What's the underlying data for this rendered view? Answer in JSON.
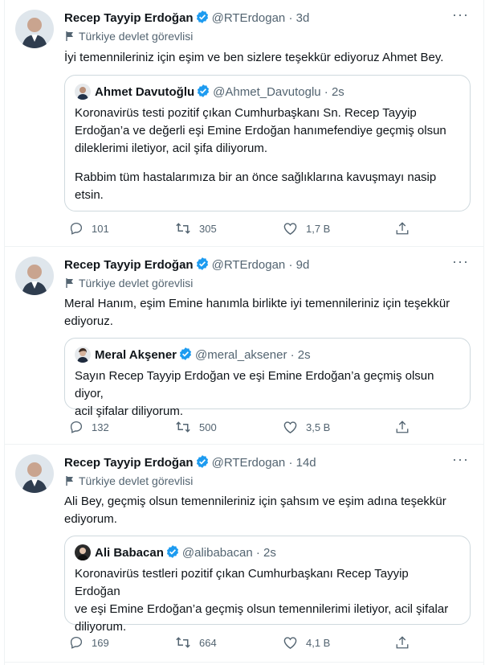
{
  "tweets": [
    {
      "name": "Recep Tayyip Erdoğan",
      "handle": "@RTErdogan · 3d",
      "label": "Türkiye devlet görevlisi",
      "text": "İyi temennileriniz için eşim ve ben sizlere teşekkür ediyoruz Ahmet Bey.",
      "quote": {
        "name": "Ahmet Davutoğlu",
        "handle": "@Ahmet_Davutoglu · 2s",
        "line1": "Koronavirüs testi pozitif çıkan Cumhurbaşkanı Sn. Recep Tayyip",
        "line2": "Erdoğan’a ve değerli eşi Emine Erdoğan hanımefendiye geçmiş olsun",
        "line3": "dileklerimi iletiyor, acil şifa diliyorum.",
        "line4": "Rabbim tüm hastalarımıza bir an önce sağlıklarına kavuşmayı nasip",
        "line5": "etsin."
      },
      "replies": "101",
      "retweets": "305",
      "likes": "1,7 B"
    },
    {
      "name": "Recep Tayyip Erdoğan",
      "handle": "@RTErdogan · 9d",
      "label": "Türkiye devlet görevlisi",
      "line1": "Meral Hanım, eşim Emine hanımla birlikte iyi temennileriniz için teşekkür",
      "line2": "ediyoruz.",
      "quote": {
        "name": "Meral Akşener",
        "handle": "@meral_aksener · 2s",
        "line1": "Sayın Recep Tayyip Erdoğan ve eşi Emine Erdoğan’a geçmiş olsun diyor,",
        "line2": "acil şifalar diliyorum."
      },
      "replies": "132",
      "retweets": "500",
      "likes": "3,5 B"
    },
    {
      "name": "Recep Tayyip Erdoğan",
      "handle": "@RTErdogan · 14d",
      "label": "Türkiye devlet görevlisi",
      "line1": "Ali Bey, geçmiş olsun temennileriniz için şahsım ve eşim adına teşekkür",
      "line2": "ediyorum.",
      "quote": {
        "name": "Ali Babacan",
        "handle": "@alibabacan · 2s",
        "line1": "Koronavirüs testleri pozitif çıkan Cumhurbaşkanı Recep Tayyip Erdoğan",
        "line2": "ve eşi Emine Erdoğan’a geçmiş olsun temennilerimi iletiyor, acil şifalar",
        "line3": "diliyorum."
      },
      "replies": "169",
      "retweets": "664",
      "likes": "4,1 B"
    }
  ],
  "more_glyph": "···",
  "colors": {
    "verified": "#1d9bf0",
    "muted": "#536471",
    "border": "#cfd9de"
  }
}
